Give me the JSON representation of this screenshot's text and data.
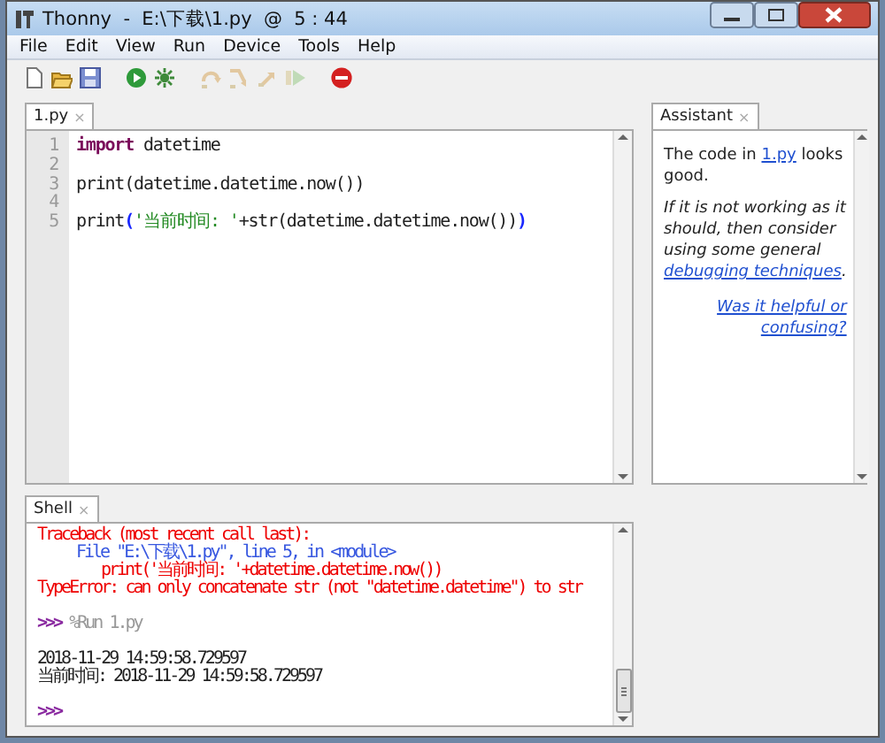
{
  "window": {
    "title": "Thonny  -  E:\\下载\\1.py  @  5 : 44"
  },
  "menu": [
    "File",
    "Edit",
    "View",
    "Run",
    "Device",
    "Tools",
    "Help"
  ],
  "toolbar": [
    {
      "kind": "new",
      "disabled": false
    },
    {
      "kind": "open",
      "disabled": false
    },
    {
      "kind": "save",
      "disabled": false
    },
    {
      "kind": "run",
      "disabled": false
    },
    {
      "kind": "debug",
      "disabled": false
    },
    {
      "kind": "step-over",
      "disabled": true
    },
    {
      "kind": "step-into",
      "disabled": true
    },
    {
      "kind": "step-out",
      "disabled": true
    },
    {
      "kind": "resume",
      "disabled": true
    },
    {
      "kind": "stop",
      "disabled": false
    }
  ],
  "editor": {
    "tab": {
      "label": "1.py",
      "close": "×"
    },
    "lines": [
      {
        "number": "1",
        "tokens": [
          {
            "kind": "keyword",
            "text": "import"
          },
          {
            "kind": "plain",
            "text": " datetime"
          }
        ]
      },
      {
        "number": "2"
      },
      {
        "number": "3",
        "tokens": [
          {
            "kind": "plain",
            "text": "print(datetime.datetime.now())"
          }
        ]
      },
      {
        "number": "4"
      },
      {
        "number": "5",
        "tokens": [
          {
            "kind": "plain",
            "text": "print"
          },
          {
            "kind": "bracket",
            "text": "("
          },
          {
            "kind": "string",
            "text": "'当前时间: '"
          },
          {
            "kind": "plain",
            "text": "+str(datetime.datetime.now())"
          },
          {
            "kind": "bracket",
            "text": ")"
          }
        ]
      }
    ]
  },
  "shell": {
    "tab": {
      "label": "Shell",
      "close": "×"
    },
    "lines": [
      {
        "kind": "error",
        "text": "Traceback (most recent call last):"
      },
      {
        "kind": "trace-file",
        "text": "File \"E:\\下载\\1.py\", line 5, in <module>"
      },
      {
        "kind": "trace-code",
        "text": "print('当前时间: '+datetime.datetime.now())"
      },
      {
        "kind": "error",
        "text": "TypeError: can only concatenate str (not \"datetime.datetime\") to str"
      },
      {
        "kind": "blank"
      },
      {
        "kind": "command",
        "prompt": ">>>",
        "text": "%Run 1.py"
      },
      {
        "kind": "blank"
      },
      {
        "kind": "output",
        "text": "2018-11-29 14:59:58.729597"
      },
      {
        "kind": "output",
        "text": "当前时间: 2018-11-29 14:59:58.729597"
      },
      {
        "kind": "blank"
      },
      {
        "kind": "command",
        "prompt": ">>>"
      }
    ]
  },
  "assistant": {
    "tab": {
      "label": "Assistant",
      "close": "×"
    },
    "paragraphs": [
      {
        "kind": "normal",
        "parts": [
          {
            "kind": "text",
            "text": "The code in "
          },
          {
            "kind": "link",
            "text": "1.py"
          },
          {
            "kind": "text",
            "text": " looks good."
          }
        ]
      },
      {
        "kind": "italic",
        "parts": [
          {
            "kind": "text",
            "text": "If it is not working as it should, then consider using some general "
          },
          {
            "kind": "link",
            "text": "debugging techniques"
          },
          {
            "kind": "text",
            "text": "."
          }
        ]
      }
    ],
    "feedback": "Was it helpful or confusing?"
  }
}
